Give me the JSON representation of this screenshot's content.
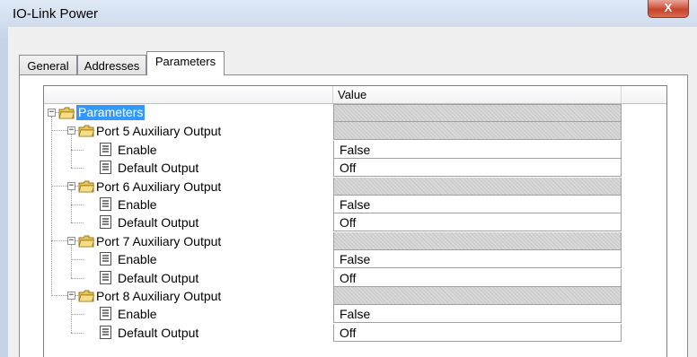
{
  "window": {
    "title": "IO-Link Power",
    "close_glyph": "X"
  },
  "tabs": [
    {
      "label": "General",
      "active": false
    },
    {
      "label": "Addresses",
      "active": false
    },
    {
      "label": "Parameters",
      "active": true
    }
  ],
  "grid": {
    "columns": [
      "",
      "Value"
    ],
    "rows": [
      {
        "level": 0,
        "type": "folder",
        "label": "Parameters",
        "value": "",
        "selected": true
      },
      {
        "level": 1,
        "type": "folder",
        "label": "Port 5 Auxiliary Output",
        "value": ""
      },
      {
        "level": 2,
        "type": "param",
        "label": "Enable",
        "value": "False"
      },
      {
        "level": 2,
        "type": "param",
        "label": "Default Output",
        "value": "Off"
      },
      {
        "level": 1,
        "type": "folder",
        "label": "Port 6 Auxiliary Output",
        "value": ""
      },
      {
        "level": 2,
        "type": "param",
        "label": "Enable",
        "value": "False"
      },
      {
        "level": 2,
        "type": "param",
        "label": "Default Output",
        "value": "Off"
      },
      {
        "level": 1,
        "type": "folder",
        "label": "Port 7 Auxiliary Output",
        "value": ""
      },
      {
        "level": 2,
        "type": "param",
        "label": "Enable",
        "value": "False"
      },
      {
        "level": 2,
        "type": "param",
        "label": "Default Output",
        "value": "Off"
      },
      {
        "level": 1,
        "type": "folder",
        "label": "Port 8 Auxiliary Output",
        "value": ""
      },
      {
        "level": 2,
        "type": "param",
        "label": "Enable",
        "value": "False"
      },
      {
        "level": 2,
        "type": "param",
        "label": "Default Output",
        "value": "Off"
      }
    ]
  },
  "icons": {
    "folder": "folder-icon",
    "param": "parameter-icon",
    "expander": "collapse-icon",
    "close": "close-icon"
  },
  "colors": {
    "selection": "#3399ff",
    "close_button": "#c7432c"
  }
}
